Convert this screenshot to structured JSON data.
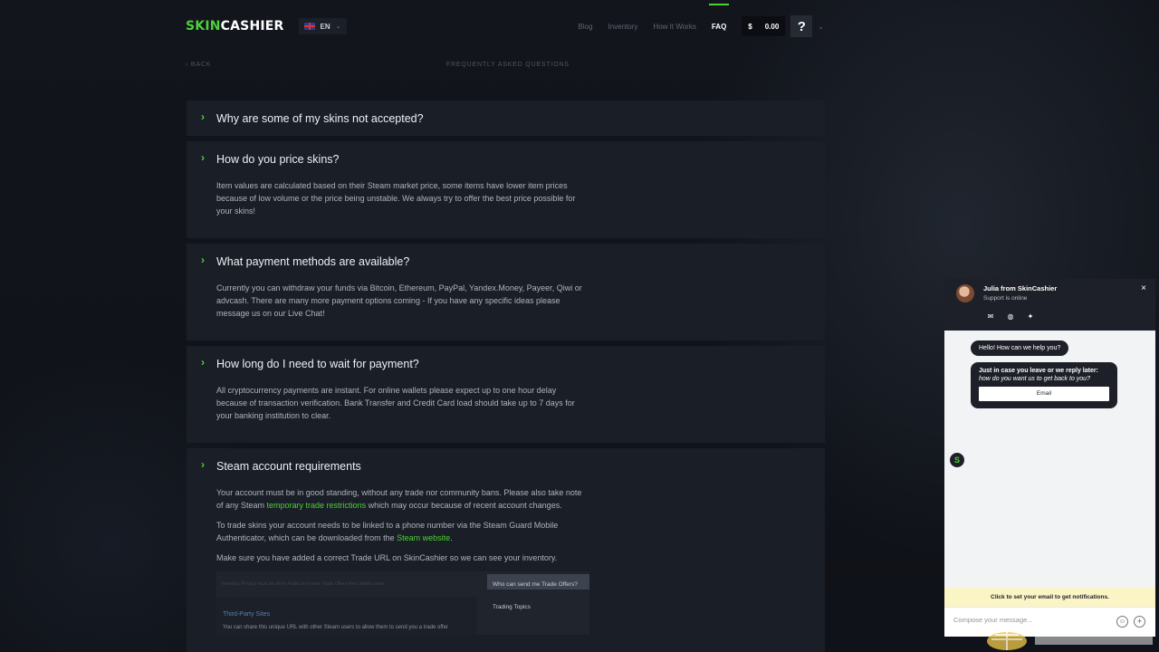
{
  "header": {
    "logo_green": "SKIN",
    "logo_white": "CASHIER",
    "language": "EN",
    "nav": [
      "Blog",
      "Inventory",
      "How It Works",
      "FAQ"
    ],
    "balance_currency": "$",
    "balance_value": "0.00",
    "help_label": "?"
  },
  "subheader": {
    "back": "‹  BACK",
    "title": "FREQUENTLY ASKED QUESTIONS"
  },
  "faq": [
    {
      "question": "Why are some of my skins not accepted?"
    },
    {
      "question": "How do you price skins?",
      "answer": "Item values are calculated based on their Steam market price, some items have lower item prices because of low volume or the price being unstable. We always try to offer the best price possible for your skins!"
    },
    {
      "question": "What payment methods are available?",
      "answer": "Currently you can withdraw your funds via Bitcoin, Ethereum, PayPal, Yandex.Money, Payeer, Qiwi or advcash. There are many more payment options coming - If you have any specific ideas please message us on our Live Chat!"
    },
    {
      "question": "How long do I need to wait for payment?",
      "answer": "All cryptocurrency payments are instant. For online wallets please expect up to one hour delay because of transaction verification. Bank Transfer and Credit Card load should take up to 7 days for your banking institution to clear."
    },
    {
      "question": "Steam account requirements",
      "p1_a": "Your account must be in good standing, without any trade nor community bans. Please also take note of any Steam ",
      "p1_link": "temporary trade restrictions",
      "p1_b": " which may occur because of recent account changes.",
      "p2_a": "To trade skins your account needs to be linked to a phone number via the Steam Guard Mobile Authenticator, which can be downloaded from the ",
      "p2_link": "Steam website",
      "p2_b": ".",
      "p3": "Make sure you have added a correct Trade URL on SkinCashier so we can see your inventory.",
      "screenshot": {
        "top_text": "Inventory Privacy must be set to Public to receive Trade Offers from Steam users.",
        "who": "Who can send me Trade Offers?",
        "topics": "Trading Topics",
        "third_party": "Third-Party Sites",
        "desc": "You can share this unique URL with other Steam users to allow them to send you a trade offer"
      }
    }
  ],
  "chat": {
    "agent": "Julia from SkinCashier",
    "status": "Support is online",
    "close": "×",
    "greeting": "Hello! How can we help you?",
    "prompt_bold": "Just in case you leave or we reply later:",
    "prompt_italic": "how do you want us to get back to you?",
    "email_button": "Email",
    "bot_initial": "S",
    "notify": "Click to set your email to get notifications.",
    "compose_placeholder": "Compose your message..."
  }
}
